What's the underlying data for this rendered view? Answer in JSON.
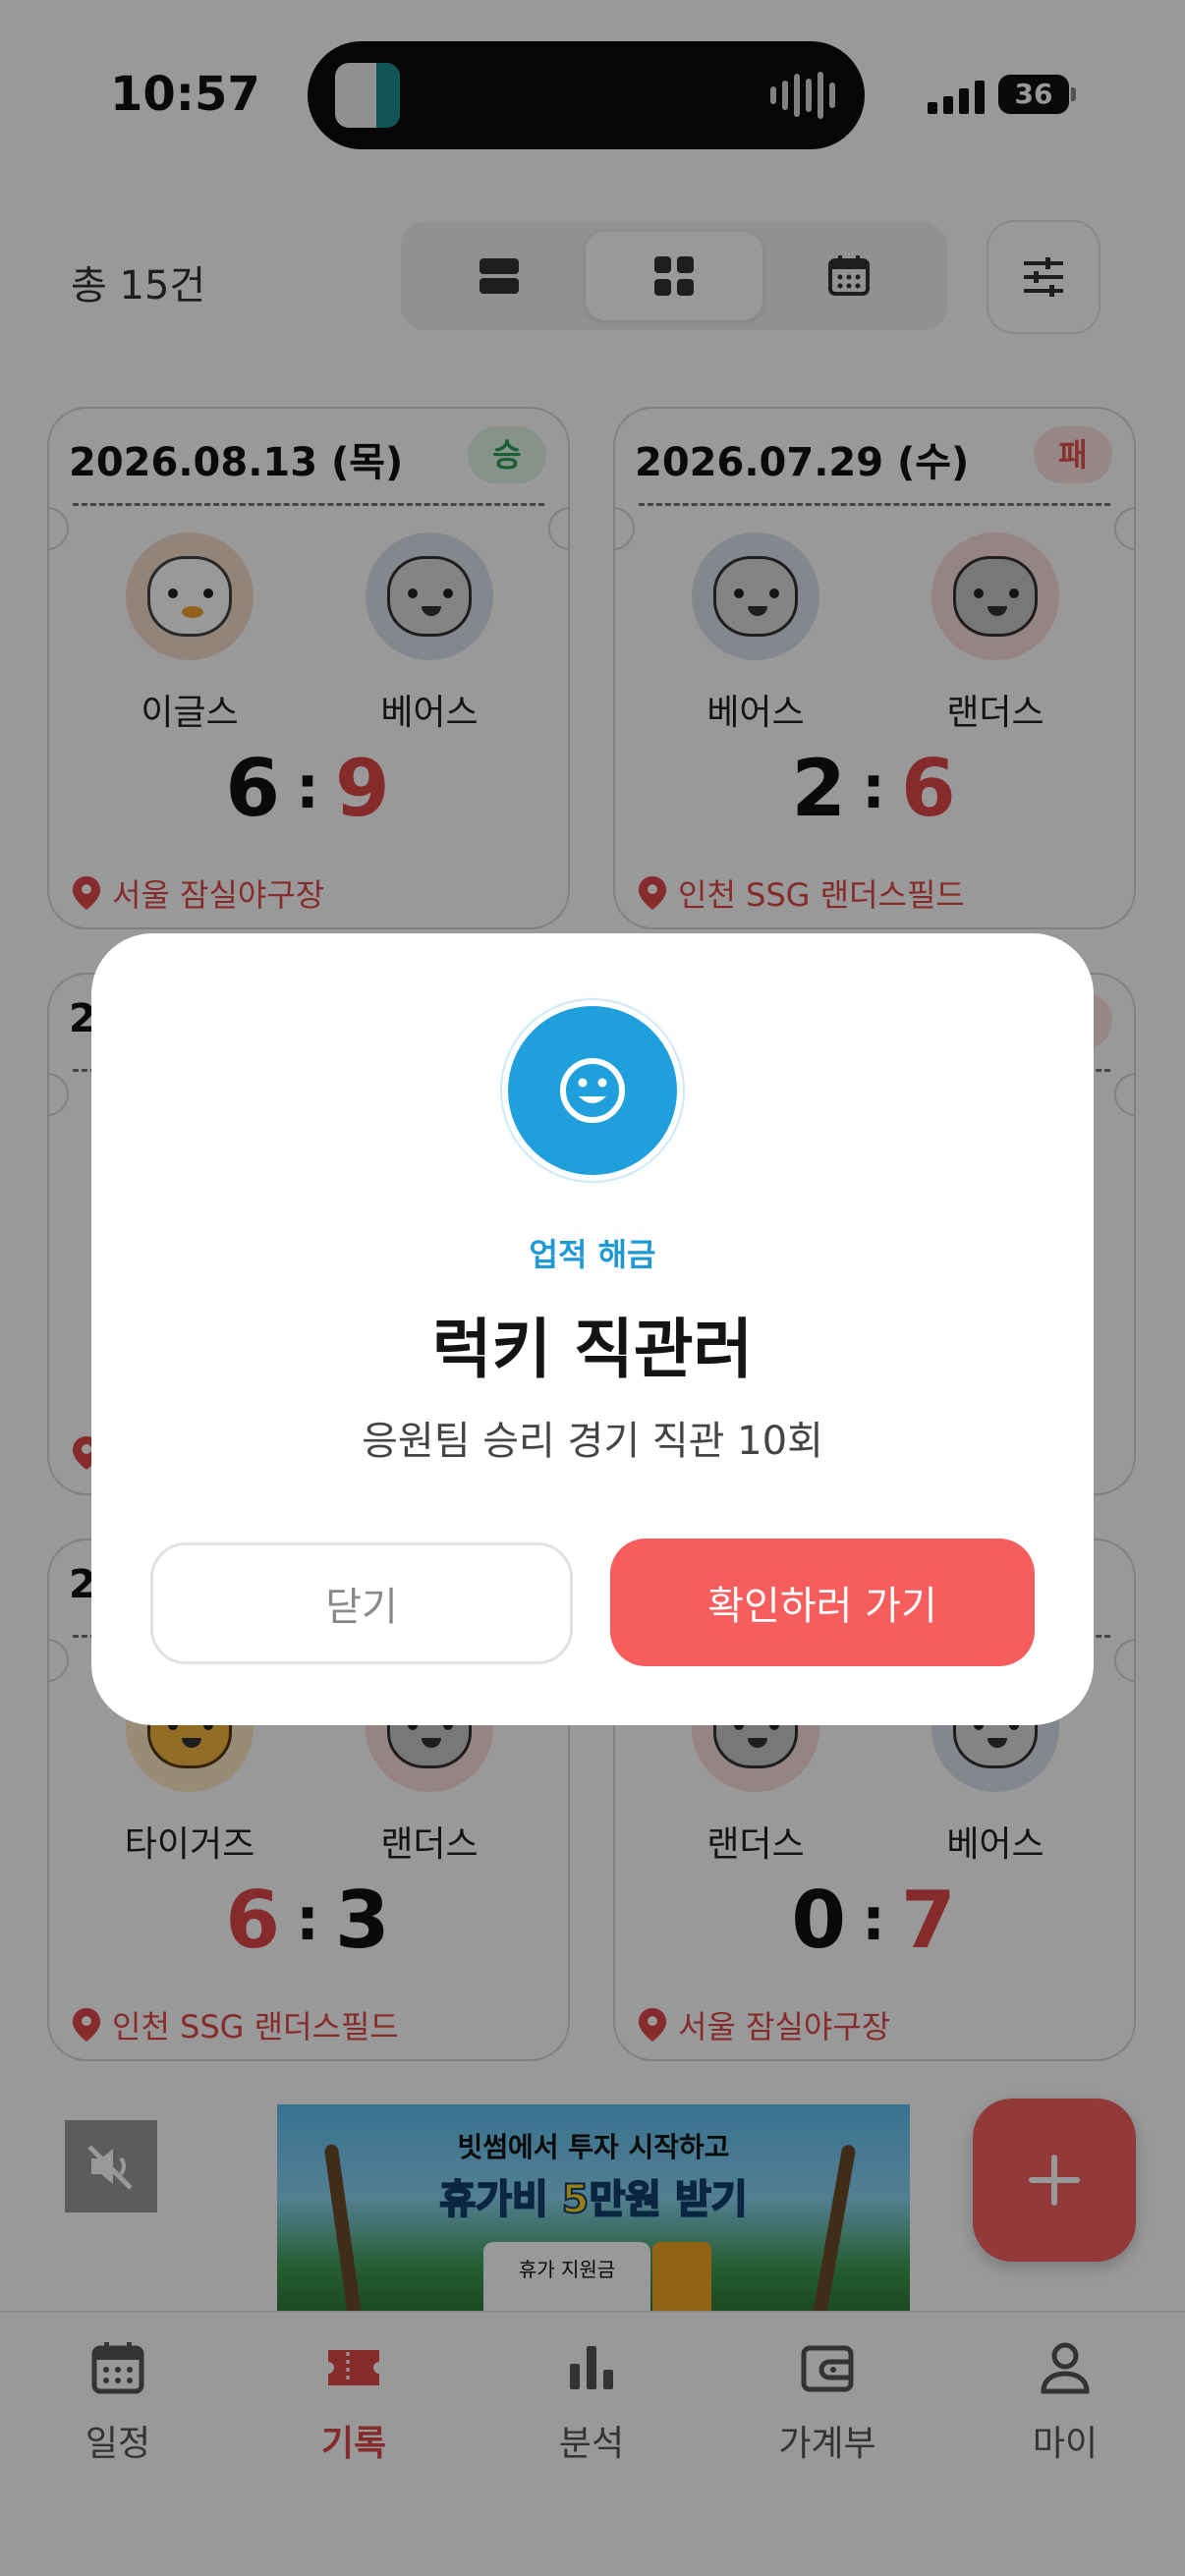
{
  "status_bar": {
    "time": "10:57",
    "battery": "36"
  },
  "toolbar": {
    "total": "총 15건",
    "view_modes": [
      "list",
      "grid",
      "calendar"
    ],
    "active_view": "grid"
  },
  "cards": [
    {
      "date": "2026.08.13 (목)",
      "result": "승",
      "home": "이글스",
      "away": "베어스",
      "home_score": "6",
      "away_score": "9",
      "location": "서울 잠실야구장"
    },
    {
      "date": "2026.07.29 (수)",
      "result": "패",
      "home": "베어스",
      "away": "랜더스",
      "home_score": "2",
      "away_score": "6",
      "location": "인천 SSG 랜더스필드"
    },
    {
      "date": "2",
      "result": "",
      "home": "",
      "away": "",
      "home_score": "",
      "away_score": "",
      "location": ""
    },
    {
      "date": "",
      "result": "",
      "home": "",
      "away": "",
      "home_score": "",
      "away_score": "",
      "location": ""
    },
    {
      "date": "2",
      "result": "",
      "home": "타이거즈",
      "away": "랜더스",
      "home_score": "6",
      "away_score": "3",
      "location": "인천 SSG 랜더스필드"
    },
    {
      "date": "",
      "result": "",
      "home": "랜더스",
      "away": "베어스",
      "home_score": "0",
      "away_score": "7",
      "location": "서울 잠실야구장"
    }
  ],
  "ad": {
    "line1": "빗썸에서 투자 시작하고",
    "line2_pre": "휴가비 ",
    "line2_highlight": "5만원",
    "line2_post": " 받기",
    "ticket": "휴가 지원금"
  },
  "tabs": [
    {
      "label": "일정",
      "icon": "calendar-icon",
      "active": false
    },
    {
      "label": "기록",
      "icon": "ticket-icon",
      "active": true
    },
    {
      "label": "분석",
      "icon": "bar-chart-icon",
      "active": false
    },
    {
      "label": "가계부",
      "icon": "wallet-icon",
      "active": false
    },
    {
      "label": "마이",
      "icon": "person-icon",
      "active": false
    }
  ],
  "dialog": {
    "label": "업적 해금",
    "title": "럭키 직관러",
    "description": "응원팀 승리 경기 직관 10회",
    "close_label": "닫기",
    "confirm_label": "확인하러 가기"
  },
  "colors": {
    "accent_red": "#F45F5F",
    "achievement_blue": "#1FA0DC",
    "win_green": "#2A9D57",
    "lose_red": "#E35252"
  }
}
